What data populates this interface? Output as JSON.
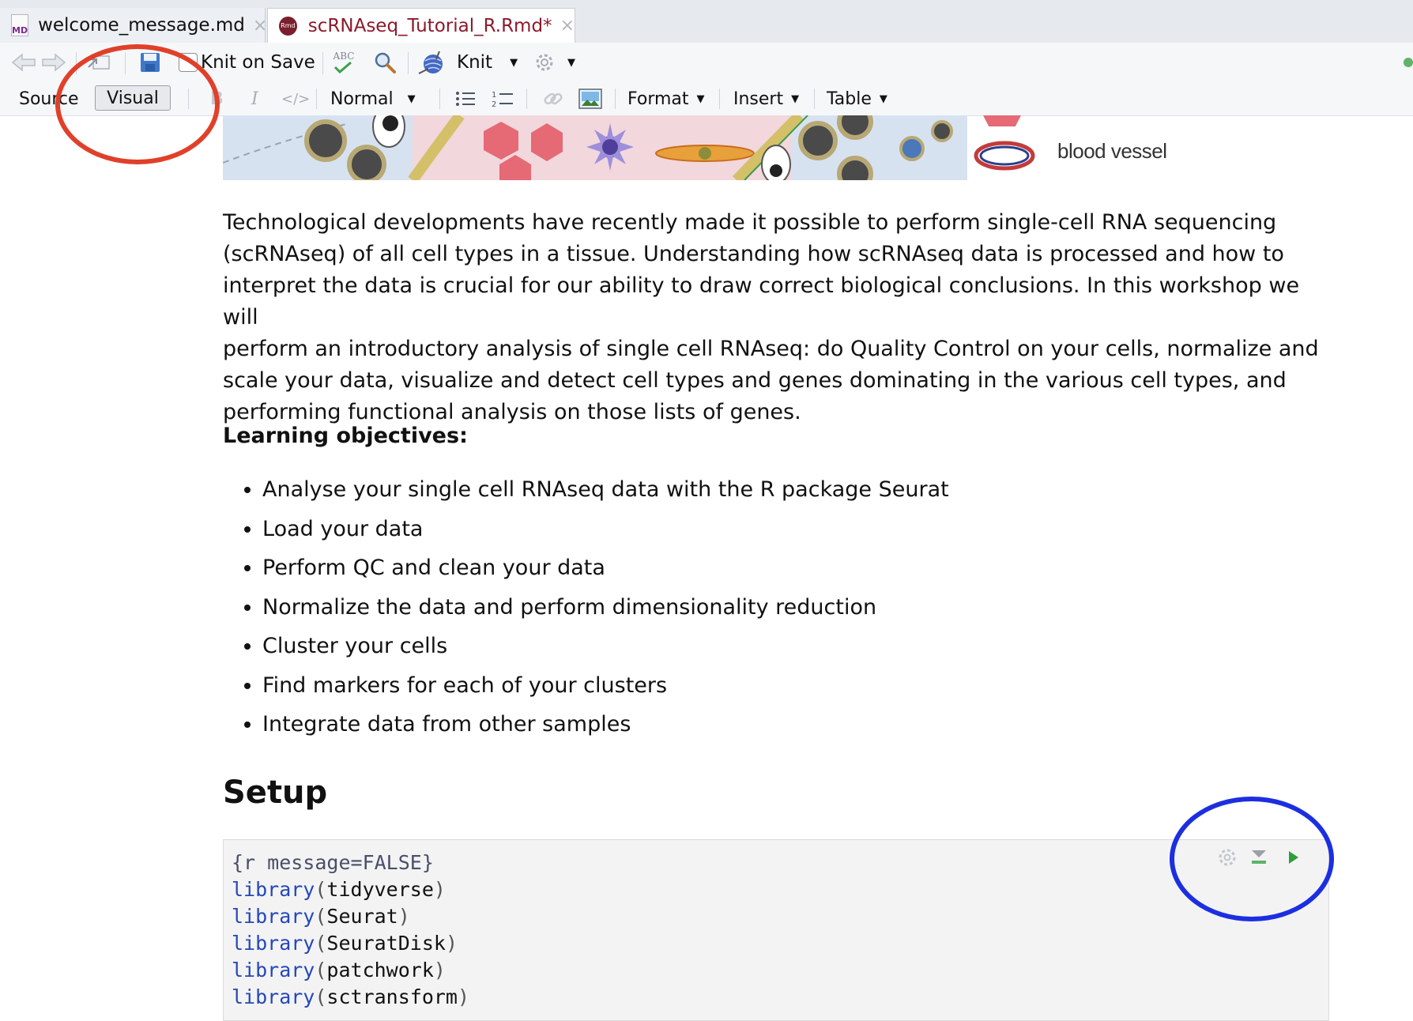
{
  "tabs": [
    {
      "label": "welcome_message.md",
      "icon": "markdown-file-icon",
      "active": false
    },
    {
      "label": "scRNAseq_Tutorial_R.Rmd*",
      "icon": "rmd-file-icon",
      "active": true
    }
  ],
  "tab_icons": {
    "md": "MD",
    "rmd": "Rmd"
  },
  "close_glyph": "×",
  "toolbar": {
    "knit_on_save": "Knit on Save",
    "spellcheck_label": "ABC",
    "knit": "Knit"
  },
  "format_toolbar": {
    "source": "Source",
    "visual": "Visual",
    "block_format": "Normal",
    "bullet_list_icon": "bullet-list-icon",
    "numbered_list_icon": "numbered-list-icon",
    "format": "Format",
    "insert": "Insert",
    "table": "Table"
  },
  "banner": {
    "label": "blood vessel"
  },
  "intro": {
    "lines": [
      "Technological developments have recently made it possible to perform single-cell RNA sequencing",
      "(scRNAseq) of all cell types in a tissue. Understanding how scRNAseq data is processed and how to",
      "interpret the data is crucial for our ability to draw correct biological conclusions. In this workshop we will",
      "perform an introductory analysis of single cell RNAseq: do Quality Control on your cells, normalize and",
      "scale your data, visualize and detect cell types and genes dominating in the various cell types, and",
      "performing functional analysis on those lists of genes."
    ]
  },
  "learning_objectives": {
    "heading": "Learning objectives:",
    "items": [
      "Analyse your single cell RNAseq data with the R package Seurat",
      "Load your data",
      "Perform QC and clean your data",
      "Normalize the data and perform dimensionality reduction",
      "Cluster your cells",
      "Find markers for each of your clusters",
      "Integrate data from other samples"
    ]
  },
  "setup": {
    "heading": "Setup",
    "chunk_header": "{r message=FALSE}",
    "code_lines": [
      {
        "fn": "library",
        "arg": "tidyverse"
      },
      {
        "fn": "library",
        "arg": "Seurat"
      },
      {
        "fn": "library",
        "arg": "SeuratDisk"
      },
      {
        "fn": "library",
        "arg": "patchwork"
      },
      {
        "fn": "library",
        "arg": "sctransform"
      }
    ]
  },
  "colors": {
    "annotation_red": "#e0402a",
    "annotation_blue": "#1c2fe0",
    "run_green": "#2e9e3a",
    "active_tab_text": "#8b1a2b"
  }
}
